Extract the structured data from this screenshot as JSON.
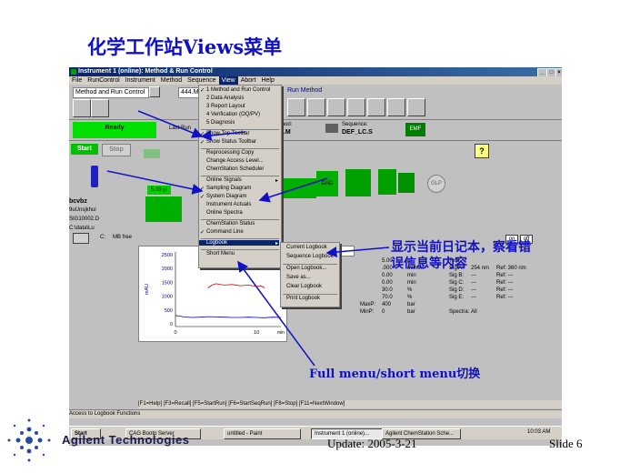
{
  "slide": {
    "title": "化学工作站Views菜单",
    "annotation_logbook": "显示当前日记本，察看错误信息等内容",
    "annotation_menu": "Full menu/short menu切换",
    "footer_update": "Update: 2005-3-21",
    "footer_slide": "Slide 6",
    "brand": "Agilent Technologies"
  },
  "window": {
    "title": "Instrument 1 (online): Method & Run Control",
    "controls": [
      "_",
      "□",
      "×"
    ]
  },
  "menubar": [
    "File",
    "RunControl",
    "Instrument",
    "Method",
    "Sequence",
    "View",
    "Abort",
    "Help"
  ],
  "toolbar": {
    "view_combo": "Method and Run Control",
    "method_combo": "444.M",
    "run_method_label": "Run Method",
    "status_ready": "Ready",
    "last_run_label": "Last Run",
    "method_label": "thod:",
    "method_value": "4.M",
    "sequence_label": "Sequence:",
    "sequence_value": "DEF_LC.S"
  },
  "view_menu": [
    {
      "label": "1 Method and Run Control",
      "checked": true
    },
    {
      "label": "2 Data Analysis",
      "checked": false
    },
    {
      "label": "3 Report Layout",
      "checked": false
    },
    {
      "label": "4 Verification (OQ/PV)",
      "checked": false
    },
    {
      "label": "5 Diagnosis",
      "checked": false
    },
    {
      "label": "Show Top Toolbar",
      "checked": true
    },
    {
      "label": "Show Status Toolbar",
      "checked": true
    },
    {
      "label": "Reprocessing Copy",
      "checked": false
    },
    {
      "label": "Change Access Level...",
      "checked": false
    },
    {
      "label": "ChemStation Scheduler",
      "checked": false
    },
    {
      "label": "Online Signals",
      "checked": false
    },
    {
      "label": "Sampling Diagram",
      "checked": true
    },
    {
      "label": "System Diagram",
      "checked": true
    },
    {
      "label": "Instrument Actuals",
      "checked": false
    },
    {
      "label": "Online Spectra",
      "checked": false
    },
    {
      "label": "ChemStation Status",
      "checked": false
    },
    {
      "label": "Command Line",
      "checked": true
    },
    {
      "label": "Logbook",
      "checked": false
    },
    {
      "label": "Short Menu",
      "checked": false
    }
  ],
  "logbook_submenu": [
    "Current Logbook",
    "Sequence Logbook",
    "Open Logbook...",
    "Save as...",
    "Clear Logbook",
    "Print Logbook"
  ],
  "diagram": {
    "start_label": "Start",
    "stop_label": "Stop",
    "volume": "5.00 µl",
    "detector": "DAD",
    "glp": "GLP",
    "on": "on",
    "off": "off",
    "help": "?"
  },
  "sample_info": {
    "name": "bcvbz",
    "line1": "9uUnsjkhui",
    "line2": "SIG10002.D",
    "line3": "C:\\data\\Lu",
    "disk": "C:",
    "disk_free": "MB free"
  },
  "chart_data": {
    "type": "line",
    "ylabel": "mAU",
    "yticks": [
      "2500",
      "2000",
      "1500",
      "1000",
      "500",
      "0"
    ],
    "xticks": [
      "0",
      "10"
    ],
    "xunit": "min",
    "ylim": [
      -100,
      2600
    ],
    "xlim": [
      0,
      13
    ],
    "series": [
      {
        "color": "#0000cc",
        "x": [
          0,
          0.5,
          1,
          2,
          3,
          4,
          5,
          6,
          7,
          8,
          9,
          10,
          11,
          12,
          13
        ],
        "y": [
          300,
          280,
          250,
          230,
          240,
          260,
          250,
          240,
          230,
          230,
          240,
          230,
          220,
          240,
          230
        ]
      },
      {
        "color": "#cc0000",
        "x": [
          4,
          4.5,
          5,
          6,
          7,
          8,
          9,
          10,
          10.5,
          11
        ],
        "y": [
          1300,
          1400,
          1450,
          1400,
          1420,
          1380,
          1400,
          1350,
          1380,
          1300
        ]
      }
    ]
  },
  "params": {
    "col1": [
      {
        "label": "",
        "value": "5.00",
        "unit": "µl"
      },
      {
        "label": "",
        "value": ".000",
        "unit": "ml/min"
      },
      {
        "label": "",
        "value": "0.00",
        "unit": "min"
      },
      {
        "label": "",
        "value": "0.00",
        "unit": "min"
      },
      {
        "label": "",
        "value": "30.0",
        "unit": "%"
      },
      {
        "label": "",
        "value": "70.0",
        "unit": "%"
      },
      {
        "label": "MaxP:",
        "value": "400",
        "unit": "bar"
      },
      {
        "label": "MinP:",
        "value": "0",
        "unit": "bar"
      }
    ],
    "col2": [
      {
        "label": "Tem",
        "value": "",
        "ref": ""
      },
      {
        "label": "Sig A:",
        "value": "254 nm",
        "ref": "Ref: 360 nm"
      },
      {
        "label": "Sig B:",
        "value": "---",
        "ref": "Ref: ---"
      },
      {
        "label": "Sig C:",
        "value": "---",
        "ref": "Ref: ---"
      },
      {
        "label": "Sig D:",
        "value": "---",
        "ref": "Ref: ---"
      },
      {
        "label": "Sig E:",
        "value": "---",
        "ref": "Ref: ---"
      },
      {
        "label": "Spectra:",
        "value": "All",
        "ref": ""
      }
    ],
    "combo_value": "ters"
  },
  "function_keys": "[F1=Help] [F3=Recall] [F5=StartRun] [F6=StartSeqRun] [F8=Stop] [F11=NextWindow]",
  "statusbar": "Access to Logbook Functions",
  "taskbar": {
    "start": "Start",
    "tasks": [
      "CAG Bootp Server",
      "untitled - Paint",
      "Instrument 1 (online)...",
      "Agilent ChemStation Sche..."
    ],
    "clock": "10:03 AM"
  },
  "colors": {
    "accent_blue": "#1010c8",
    "ready_green": "#00e000",
    "lcd_green": "#00c000"
  }
}
